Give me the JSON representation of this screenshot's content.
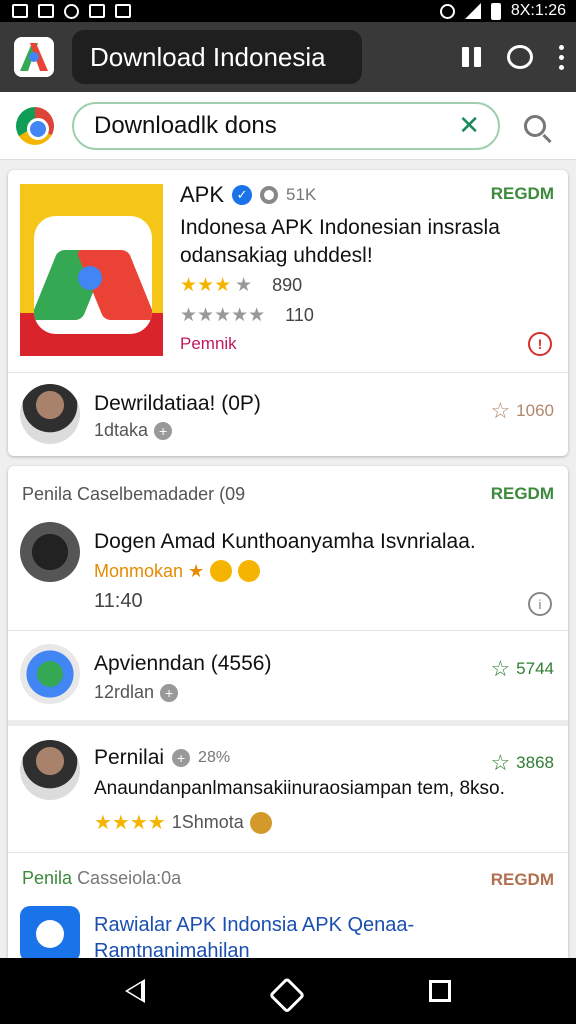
{
  "status_bar": {
    "time": "8X:1:26"
  },
  "toolbar": {
    "title": "Download Indonesia"
  },
  "search": {
    "value": "Downloadlk dons",
    "clear_symbol": "✕"
  },
  "card1": {
    "featured": {
      "name": "APK",
      "badge_count": "51K",
      "tag": "REGDM",
      "description": "Indonesa APK Indonesian insrasla odansakiag uhddesl!",
      "rating1": "890",
      "rating2": "110",
      "note": "Pemnik"
    },
    "row": {
      "title": "Dewrildatiaa! (0P)",
      "sub": "1dtaka",
      "rating": "1060"
    }
  },
  "card2": {
    "header": "Penila Caselbemadader (09",
    "header_tag": "REGDM",
    "items": [
      {
        "title": "Dogen Amad Kunthoanyamha Isvnrialaa.",
        "sub": "Monmokan ★",
        "time": "11:40"
      },
      {
        "title": "Apvienndan (4556)",
        "sub": "12rdlan",
        "rating": "5744"
      },
      {
        "title": "Pernilai",
        "count": "28%",
        "desc": "Anaundanpanlmansakiinuraosiampan tem, 8kso.",
        "sub": "1Shmota",
        "rating": "3868"
      }
    ],
    "section2": {
      "label_green": "Penila",
      "label_grey": "Casseiola:0a",
      "tag": "REGDM",
      "title": "Rawialar APK Indonsia APK Qenaa-Ramtnanimahilan"
    }
  },
  "colors": {
    "toolbar": "#393939",
    "accent_green": "#3c8a3c",
    "link_blue": "#1a4fb0",
    "star_yellow": "#f4b400"
  }
}
